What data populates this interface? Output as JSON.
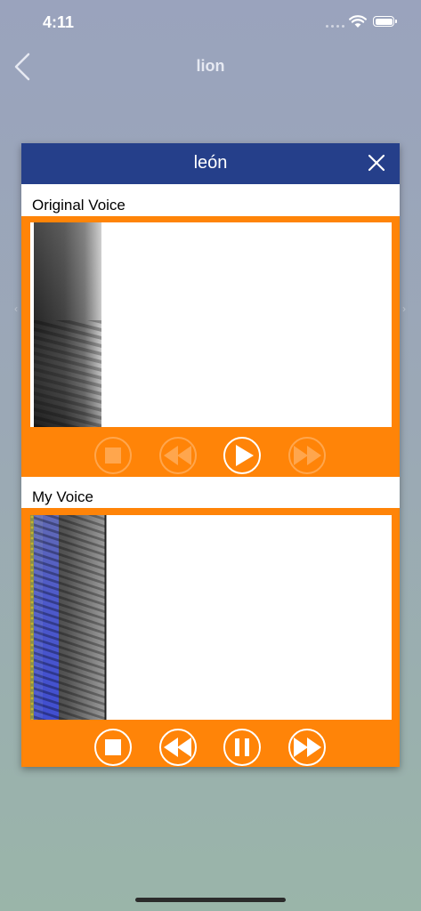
{
  "status_bar": {
    "time": "4:11"
  },
  "nav": {
    "title": "lion",
    "back_icon": "chevron-left-icon"
  },
  "modal": {
    "title": "león",
    "close_icon": "close-icon",
    "header_color": "#253f8a",
    "accent_color": "#ff8408"
  },
  "sections": {
    "original": {
      "label": "Original Voice",
      "controls": [
        {
          "icon": "stop-icon",
          "enabled": false
        },
        {
          "icon": "rewind-icon",
          "enabled": false
        },
        {
          "icon": "play-icon",
          "enabled": true
        },
        {
          "icon": "fast-forward-icon",
          "enabled": false
        }
      ]
    },
    "mine": {
      "label": "My Voice",
      "controls": [
        {
          "icon": "stop-icon",
          "enabled": true
        },
        {
          "icon": "rewind-icon",
          "enabled": true
        },
        {
          "icon": "pause-icon",
          "enabled": true
        },
        {
          "icon": "fast-forward-icon",
          "enabled": true
        }
      ]
    }
  }
}
